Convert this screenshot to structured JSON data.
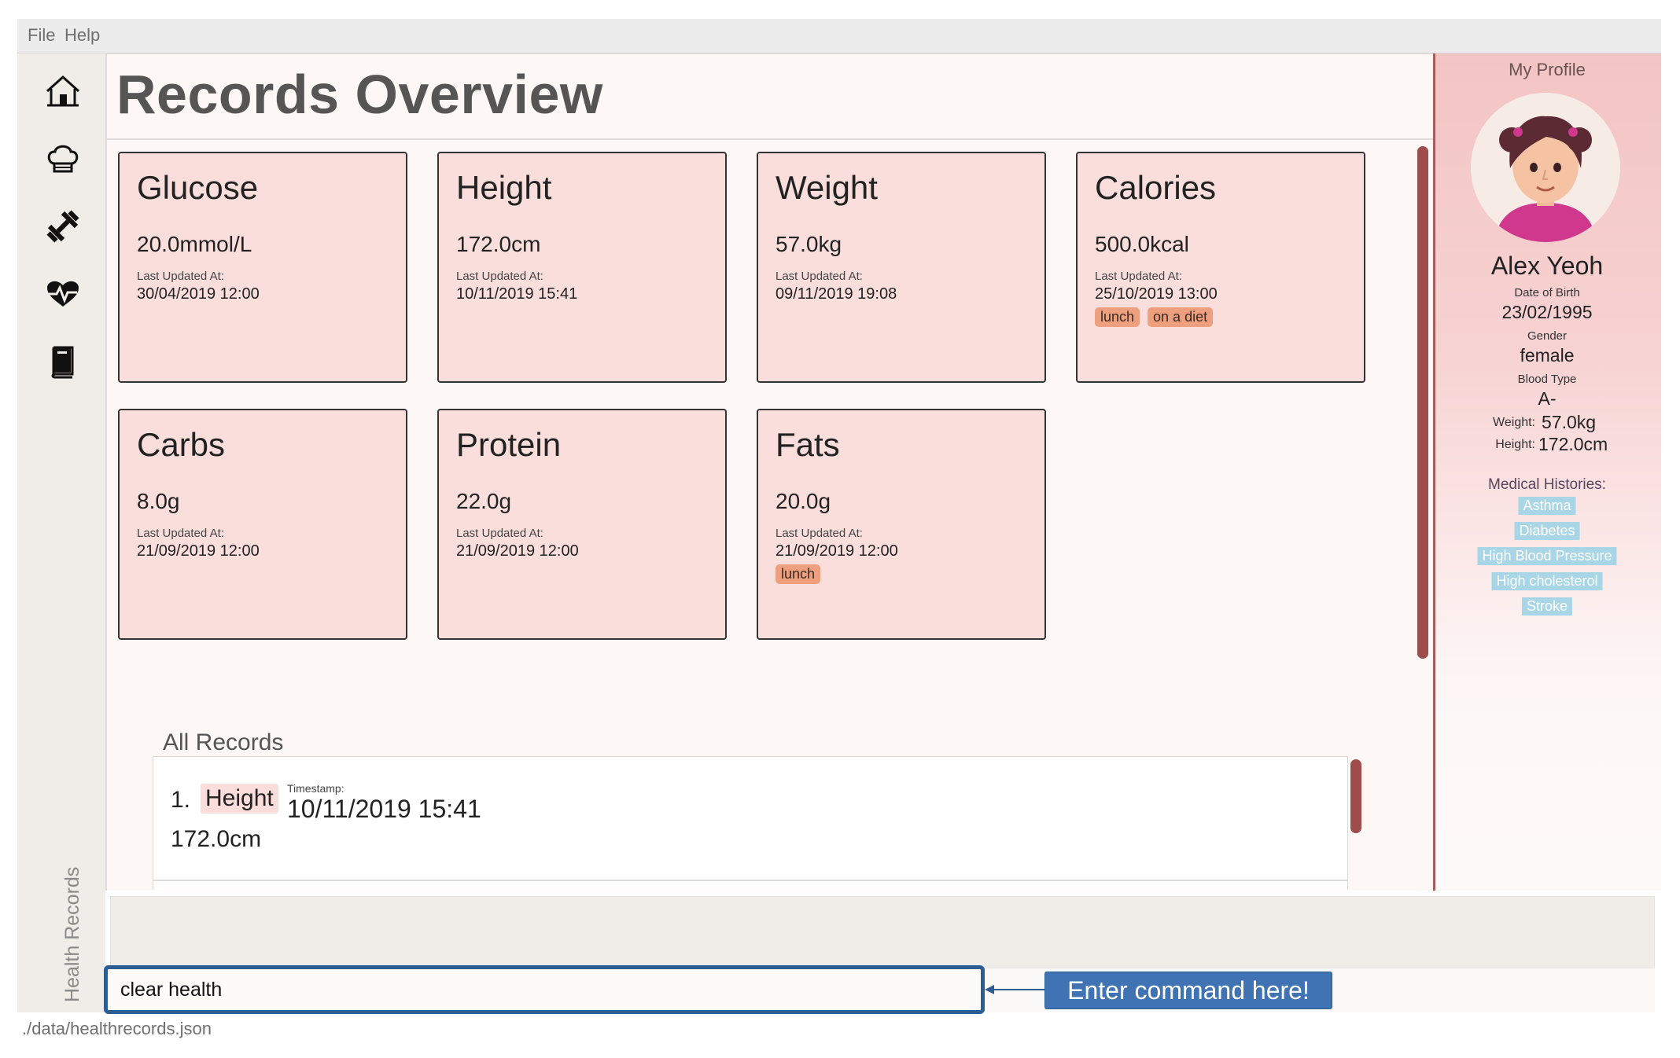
{
  "menu": {
    "items": [
      "File",
      "Help"
    ]
  },
  "sidebar": {
    "icons": [
      "home-icon",
      "chef-hat-icon",
      "dumbbell-icon",
      "heartbeat-icon",
      "book-icon"
    ],
    "caption": "Health Records"
  },
  "main": {
    "title": "Records Overview",
    "cards": [
      {
        "title": "Glucose",
        "value": "20.0mmol/L",
        "updated_label": "Last Updated At:",
        "updated": "30/04/2019 12:00",
        "tags": []
      },
      {
        "title": "Height",
        "value": "172.0cm",
        "updated_label": "Last Updated At:",
        "updated": "10/11/2019 15:41",
        "tags": []
      },
      {
        "title": "Weight",
        "value": "57.0kg",
        "updated_label": "Last Updated At:",
        "updated": "09/11/2019 19:08",
        "tags": []
      },
      {
        "title": "Calories",
        "value": "500.0kcal",
        "updated_label": "Last Updated At:",
        "updated": "25/10/2019 13:00",
        "tags": [
          "lunch",
          "on a diet"
        ]
      },
      {
        "title": "Carbs",
        "value": "8.0g",
        "updated_label": "Last Updated At:",
        "updated": "21/09/2019 12:00",
        "tags": []
      },
      {
        "title": "Protein",
        "value": "22.0g",
        "updated_label": "Last Updated At:",
        "updated": "21/09/2019 12:00",
        "tags": []
      },
      {
        "title": "Fats",
        "value": "20.0g",
        "updated_label": "Last Updated At:",
        "updated": "21/09/2019 12:00",
        "tags": [
          "lunch"
        ]
      }
    ],
    "all_records": {
      "title": "All Records",
      "items": [
        {
          "index": "1.",
          "type": "Height",
          "timestamp_label": "Timestamp:",
          "timestamp": "10/11/2019 15:41",
          "value": "172.0cm"
        }
      ]
    }
  },
  "profile": {
    "title": "My Profile",
    "name": "Alex Yeoh",
    "dob_label": "Date of Birth",
    "dob": "23/02/1995",
    "gender_label": "Gender",
    "gender": "female",
    "blood_label": "Blood Type",
    "blood": "A-",
    "weight_label": "Weight:",
    "weight": "57.0kg",
    "height_label": "Height:",
    "height": "172.0cm",
    "medical_label": "Medical Histories:",
    "medical": [
      "Asthma",
      "Diabetes",
      "High Blood Pressure",
      "High cholesterol",
      "Stroke"
    ]
  },
  "command": {
    "value": "clear health",
    "hint": "Enter command here!",
    "result": ""
  },
  "status_bar": {
    "path": "./data/healthrecords.json"
  },
  "colors": {
    "card_bg": "#f9dedb",
    "tag_bg": "#ee9f7e",
    "medical_tag_bg": "#a9d6e6",
    "accent_border": "#2c5d93",
    "hint_bg": "#3f73b4",
    "scrollbar": "#9e4c4c"
  }
}
